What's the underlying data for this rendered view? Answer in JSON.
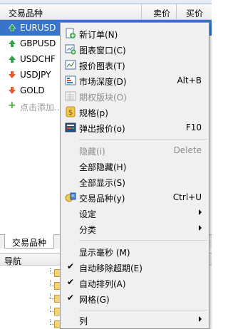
{
  "market_watch": {
    "columns": {
      "symbol": "交易品种",
      "bid": "卖价",
      "ask": "买价"
    },
    "rows": [
      {
        "symbol": "EURUSD",
        "direction": "up",
        "selected": true
      },
      {
        "symbol": "GBPUSD",
        "direction": "up",
        "selected": false
      },
      {
        "symbol": "USDCHF",
        "direction": "up",
        "selected": false
      },
      {
        "symbol": "USDJPY",
        "direction": "down",
        "selected": false
      },
      {
        "symbol": "GOLD",
        "direction": "down",
        "selected": false
      }
    ],
    "add_row_label": "点击添加.."
  },
  "bottom_tab": {
    "label": "交易品种"
  },
  "navigator": {
    "title": "导航"
  },
  "context_menu": {
    "new_order": {
      "label": "新订单(N)"
    },
    "chart_window": {
      "label": "图表窗口(C)"
    },
    "tick_chart": {
      "label": "报价图表(T)"
    },
    "depth_of_market": {
      "label": "市场深度(D)",
      "shortcut": "Alt+B"
    },
    "options_board": {
      "label": "期权版块(O)"
    },
    "specification": {
      "label": "规格(p)"
    },
    "popup_prices": {
      "label": "弹出报价(o)",
      "shortcut": "F10"
    },
    "hide": {
      "label": "隐藏(i)",
      "shortcut": "Delete"
    },
    "hide_all": {
      "label": "全部隐藏(H)"
    },
    "show_all": {
      "label": "全部显示(S)"
    },
    "symbols": {
      "label": "交易品种(y)",
      "shortcut": "Ctrl+U"
    },
    "sets": {
      "label": "设定"
    },
    "sort": {
      "label": "分类"
    },
    "show_ms": {
      "label": "显示毫秒 (M)"
    },
    "auto_remove_expired": {
      "label": "自动移除超期(E)"
    },
    "auto_arrange": {
      "label": "自动排列(A)"
    },
    "grid": {
      "label": "网格(G)"
    },
    "columns": {
      "label": "列"
    }
  },
  "colors": {
    "selection": "#3875c9",
    "up_arrow": "#2fa34a",
    "down_arrow": "#e05a2b"
  }
}
